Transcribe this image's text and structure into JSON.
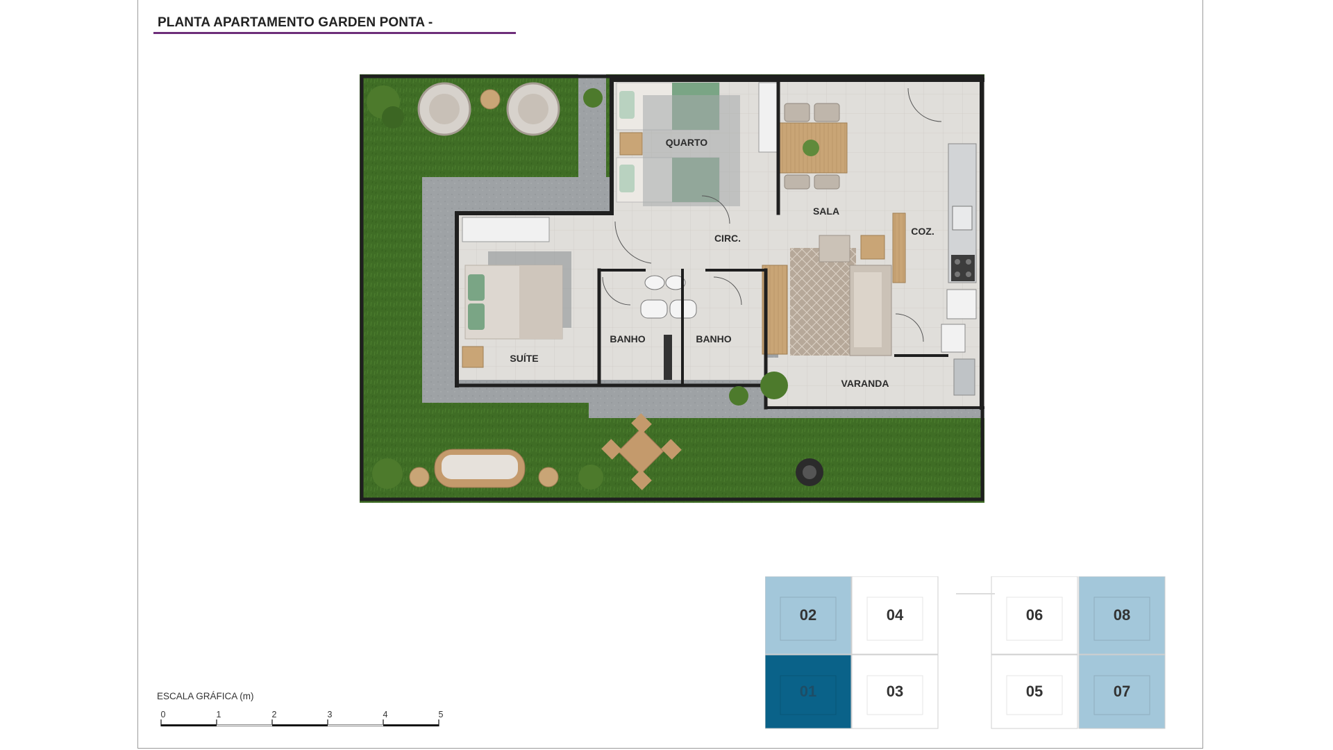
{
  "title": "PLANTA APARTAMENTO GARDEN PONTA -",
  "rooms": {
    "quarto": "QUARTO",
    "sala": "SALA",
    "circ": "CIRC.",
    "coz": "COZ.",
    "suite": "SUÍTE",
    "banho_1": "BANHO",
    "banho_2": "BANHO",
    "varanda": "VARANDA"
  },
  "scale": {
    "title": "ESCALA GRÁFICA (m)",
    "ticks": [
      "0",
      "1",
      "2",
      "3",
      "4",
      "5"
    ]
  },
  "key_plan": {
    "selected_unit": "01",
    "units": [
      {
        "id": "02",
        "label": "02",
        "state": "highlighted"
      },
      {
        "id": "04",
        "label": "04",
        "state": "default"
      },
      {
        "id": "01",
        "label": "01",
        "state": "selected"
      },
      {
        "id": "03",
        "label": "03",
        "state": "default"
      },
      {
        "id": "06",
        "label": "06",
        "state": "default"
      },
      {
        "id": "08",
        "label": "08",
        "state": "highlighted"
      },
      {
        "id": "05",
        "label": "05",
        "state": "default"
      },
      {
        "id": "07",
        "label": "07",
        "state": "highlighted"
      }
    ]
  },
  "colors": {
    "title_underline": "#6e2e7a",
    "grass": "#3f6d25",
    "path": "#9a9ea1",
    "floor": "#dedcd8",
    "wall": "#1f1f1f",
    "unit_highlighted": "#a3c7da",
    "unit_selected": "#0a6289",
    "unit_default": "#ffffff"
  },
  "icons": [
    "palm-plant-icon",
    "round-armchair-icon",
    "side-table-icon",
    "sofa-icon",
    "dining-table-icon",
    "barbecue-grill-icon",
    "bed-icon",
    "toilet-icon",
    "sink-icon",
    "stove-icon",
    "door-swing-icon"
  ]
}
